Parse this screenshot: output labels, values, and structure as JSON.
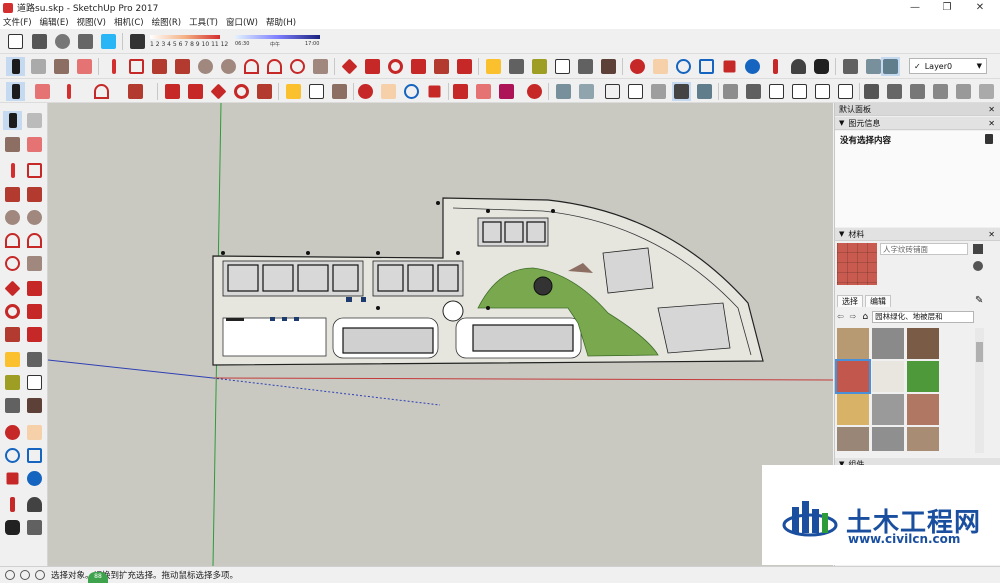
{
  "window": {
    "title": "道路su.skp - SketchUp Pro 2017",
    "controls": [
      "—",
      "❐",
      "✕"
    ]
  },
  "menu": [
    "文件(F)",
    "编辑(E)",
    "视图(V)",
    "相机(C)",
    "绘图(R)",
    "工具(T)",
    "窗口(W)",
    "帮助(H)"
  ],
  "shadow": {
    "months": "1 2 3 4 5 6 7 8 9 10 11 12",
    "time_start": "06:30",
    "noon": "中午",
    "time_end": "17:00"
  },
  "layer": {
    "current": "Layer0",
    "check": "✓"
  },
  "toolbar_colors": {
    "select": "#1b1b1b",
    "eraser": "#e57373",
    "paint": "#8d6e63",
    "pencil": "#d32f2f",
    "shape": "#b23a2e",
    "move": "#c62828",
    "tape": "#fbc02d",
    "camera": "#1565c0",
    "view": "#455a64",
    "green": "#2e7d32",
    "teal": "#00838f"
  },
  "panel": {
    "tray_title": "默认面板",
    "entity_info": "图元信息",
    "no_selection": "没有选择内容",
    "materials_title": "材料",
    "material_name": "人字纹砖铺面",
    "tab_select": "选择",
    "tab_edit": "编辑",
    "category": "园林绿化、地被层和",
    "nav_back": "⇦",
    "nav_forward": "⇨",
    "house": "⌂",
    "partial_title": "组件",
    "close": "✕",
    "collapse": "▼",
    "eyedropper": "✎"
  },
  "swatches": [
    {
      "name": "gravel-tan",
      "color": "#b89a72"
    },
    {
      "name": "gravel-grey",
      "color": "#8a8a8a"
    },
    {
      "name": "pebbles-brown",
      "color": "#7a5c46"
    },
    {
      "name": "brick-red",
      "color": "#c2574d"
    },
    {
      "name": "paving-white",
      "color": "#e8e6df"
    },
    {
      "name": "grass-green",
      "color": "#4e9a3a"
    },
    {
      "name": "sand-yellow",
      "color": "#d8b267"
    },
    {
      "name": "grate-grey",
      "color": "#9a9a9a"
    },
    {
      "name": "rock-red",
      "color": "#b07862"
    },
    {
      "name": "stone-mixed",
      "color": "#9a8676"
    },
    {
      "name": "stone-grey",
      "color": "#8f8f8f"
    },
    {
      "name": "stone-tan",
      "color": "#a88d74"
    }
  ],
  "status": {
    "text": "选择对象。切换到扩充选择。拖动鼠标选择多项。",
    "bubble": "88"
  },
  "watermark": {
    "title": "土木工程网",
    "url": "www.civilcn.com"
  }
}
